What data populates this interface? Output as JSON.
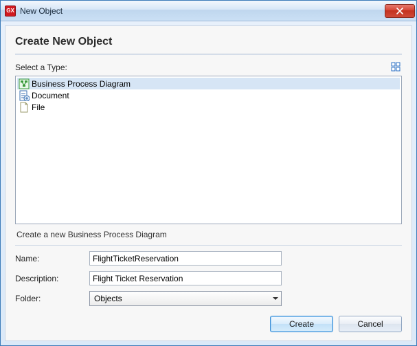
{
  "window": {
    "title": "New Object",
    "app_icon_label": "GX"
  },
  "heading": "Create New Object",
  "select_label": "Select a Type:",
  "types": [
    {
      "label": "Business Process Diagram",
      "icon": "bpd"
    },
    {
      "label": "Document",
      "icon": "document"
    },
    {
      "label": "File",
      "icon": "file"
    }
  ],
  "selected_type_index": 0,
  "description_text": "Create a new Business Process Diagram",
  "form": {
    "name_label": "Name:",
    "name_value": "FlightTicketReservation",
    "description_label": "Description:",
    "description_value": "Flight Ticket Reservation",
    "folder_label": "Folder:",
    "folder_value": "Objects"
  },
  "buttons": {
    "create": "Create",
    "cancel": "Cancel"
  }
}
